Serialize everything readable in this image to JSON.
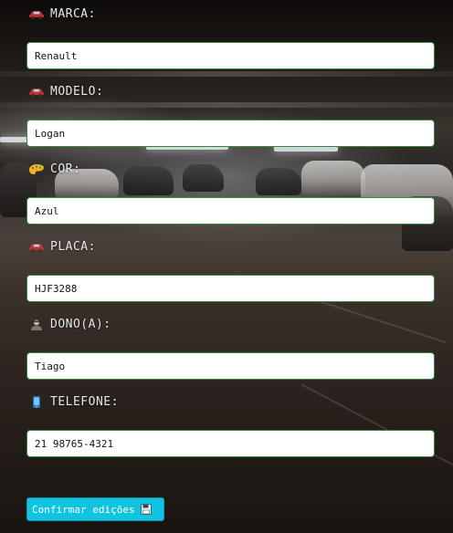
{
  "form": {
    "fields": [
      {
        "key": "marca",
        "label": "MARCA:",
        "icon": "car-icon",
        "value": "Renault"
      },
      {
        "key": "modelo",
        "label": "MODELO:",
        "icon": "car-icon",
        "value": "Logan"
      },
      {
        "key": "cor",
        "label": "COR:",
        "icon": "palette-icon",
        "value": "Azul"
      },
      {
        "key": "placa",
        "label": "PLACA:",
        "icon": "car-icon",
        "value": "HJF3288"
      },
      {
        "key": "dono",
        "label": "DONO(A):",
        "icon": "person-icon",
        "value": "Tiago"
      },
      {
        "key": "telefone",
        "label": "TELEFONE:",
        "icon": "phone-icon",
        "value": "21 98765-4321"
      }
    ],
    "confirm_label": "Confirmar edições",
    "confirm_icon": "floppy-disk-icon"
  },
  "colors": {
    "field_border": "#2f8a3a",
    "button_bg": "#10c4df",
    "label_text": "#e8e8e8"
  }
}
